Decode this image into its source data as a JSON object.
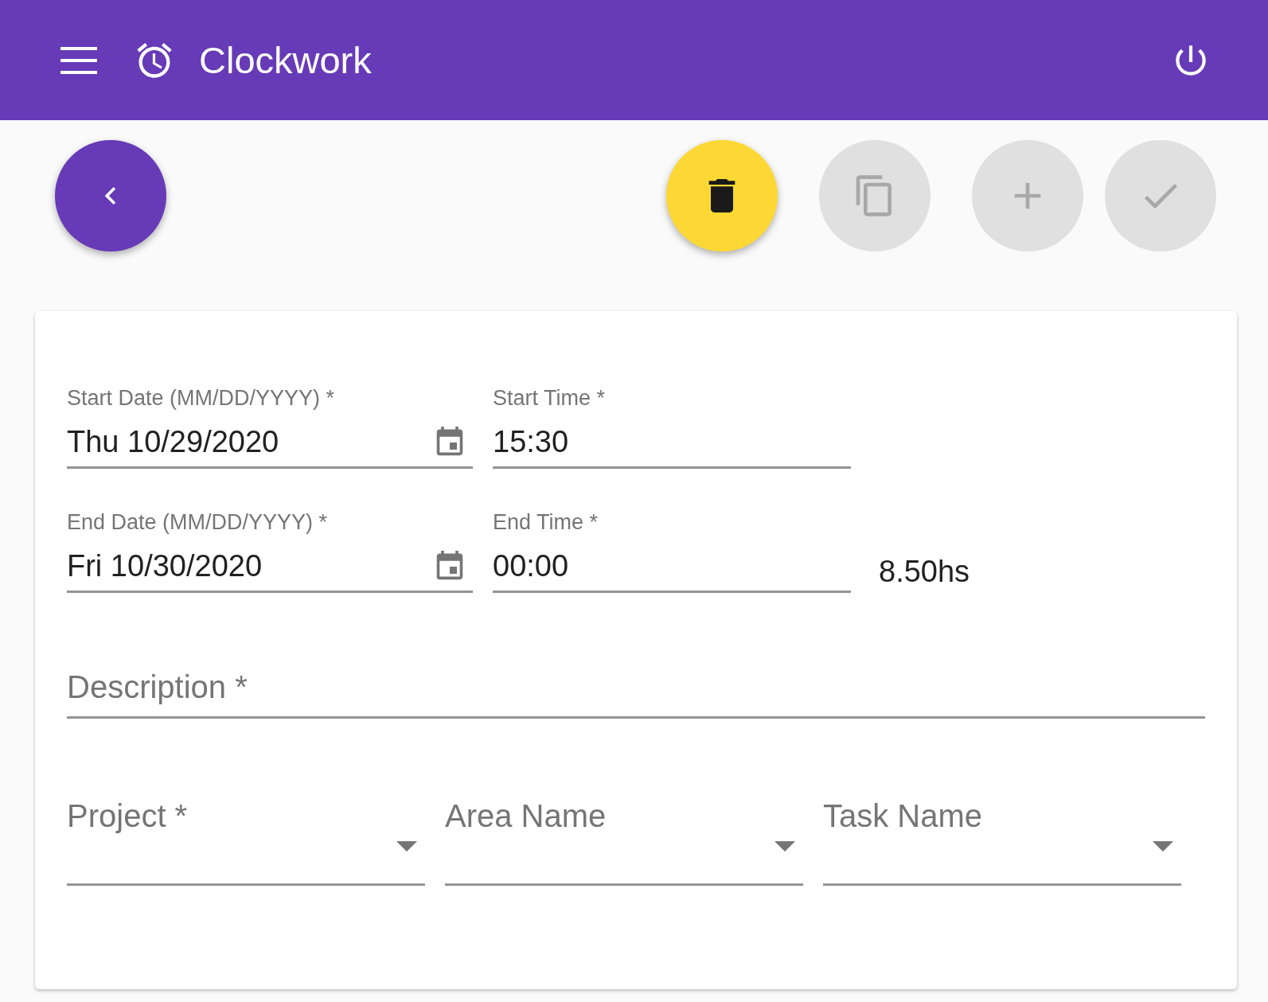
{
  "app_bar": {
    "title": "Clockwork"
  },
  "actions": [
    {
      "kind": "back",
      "disabled": false
    },
    {
      "kind": "delete",
      "disabled": false
    },
    {
      "kind": "copy",
      "disabled": true
    },
    {
      "kind": "add",
      "disabled": true
    },
    {
      "kind": "save",
      "disabled": true
    }
  ],
  "rows": [
    {
      "fields": [
        {
          "kind": "date",
          "label": "Start Date (MM/DD/YYYY) *",
          "value": "Thu 10/29/2020"
        },
        {
          "kind": "time",
          "label": "Start Time *",
          "value": "15:30"
        }
      ]
    },
    {
      "fields": [
        {
          "kind": "date",
          "label": "End Date (MM/DD/YYYY) *",
          "value": "Fri 10/30/2020"
        },
        {
          "kind": "time",
          "label": "End Time *",
          "value": "00:00"
        }
      ],
      "duration": "8.50hs"
    }
  ],
  "description": {
    "placeholder": "Description *"
  },
  "selects": [
    {
      "label": "Project *"
    },
    {
      "label": "Area Name"
    },
    {
      "label": "Task Name"
    }
  ]
}
